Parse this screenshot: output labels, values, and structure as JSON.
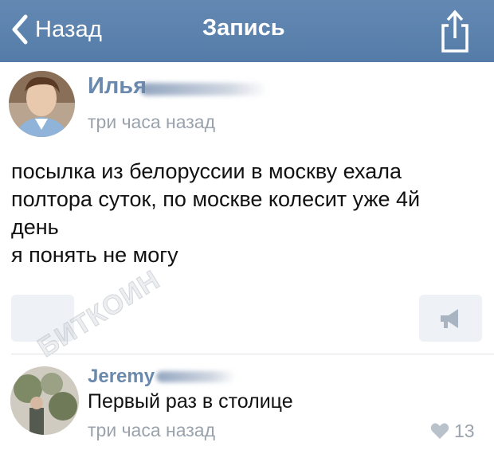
{
  "navbar": {
    "back_label": "Назад",
    "title": "Запись",
    "background": "#5b82ad"
  },
  "post": {
    "author_name": "Илья",
    "time": "три часа назад",
    "text_lines": [
      "посылка из белоруссии в москву ехала",
      "полтора суток, по москве колесит уже 4й",
      "день",
      "я понять не могу"
    ]
  },
  "watermark": "БИТКОИН",
  "comment": {
    "author_name": "Jeremy",
    "text": "Первый раз в столице",
    "time": "три часа назад",
    "likes": "13"
  },
  "icons": {
    "back": "chevron-left-icon",
    "share": "share-icon",
    "repost": "megaphone-icon",
    "like": "heart-icon"
  },
  "colors": {
    "link": "#6b89ac",
    "meta": "#9aa3ad",
    "text": "#111111"
  }
}
